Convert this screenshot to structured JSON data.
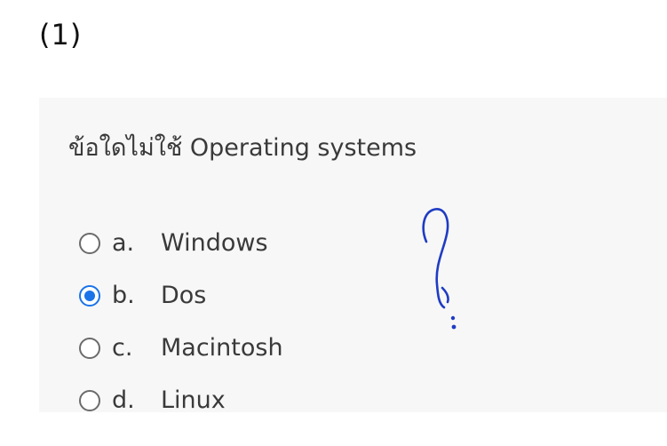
{
  "question_number": "(1)",
  "question": {
    "text": "ข้อใดไม่ใช้ Operating systems"
  },
  "options": [
    {
      "letter": "a.",
      "label": "Windows",
      "selected": false
    },
    {
      "letter": "b.",
      "label": "Dos",
      "selected": true
    },
    {
      "letter": "c.",
      "label": "Macintosh",
      "selected": false
    },
    {
      "letter": "d.",
      "label": "Linux",
      "selected": false
    }
  ],
  "annotation": {
    "icon": "handwritten-question-mark",
    "color": "#1f3cc4"
  },
  "colors": {
    "accent": "#1a73e8",
    "card_background": "#f7f7f7",
    "text": "#3a3a3a"
  }
}
